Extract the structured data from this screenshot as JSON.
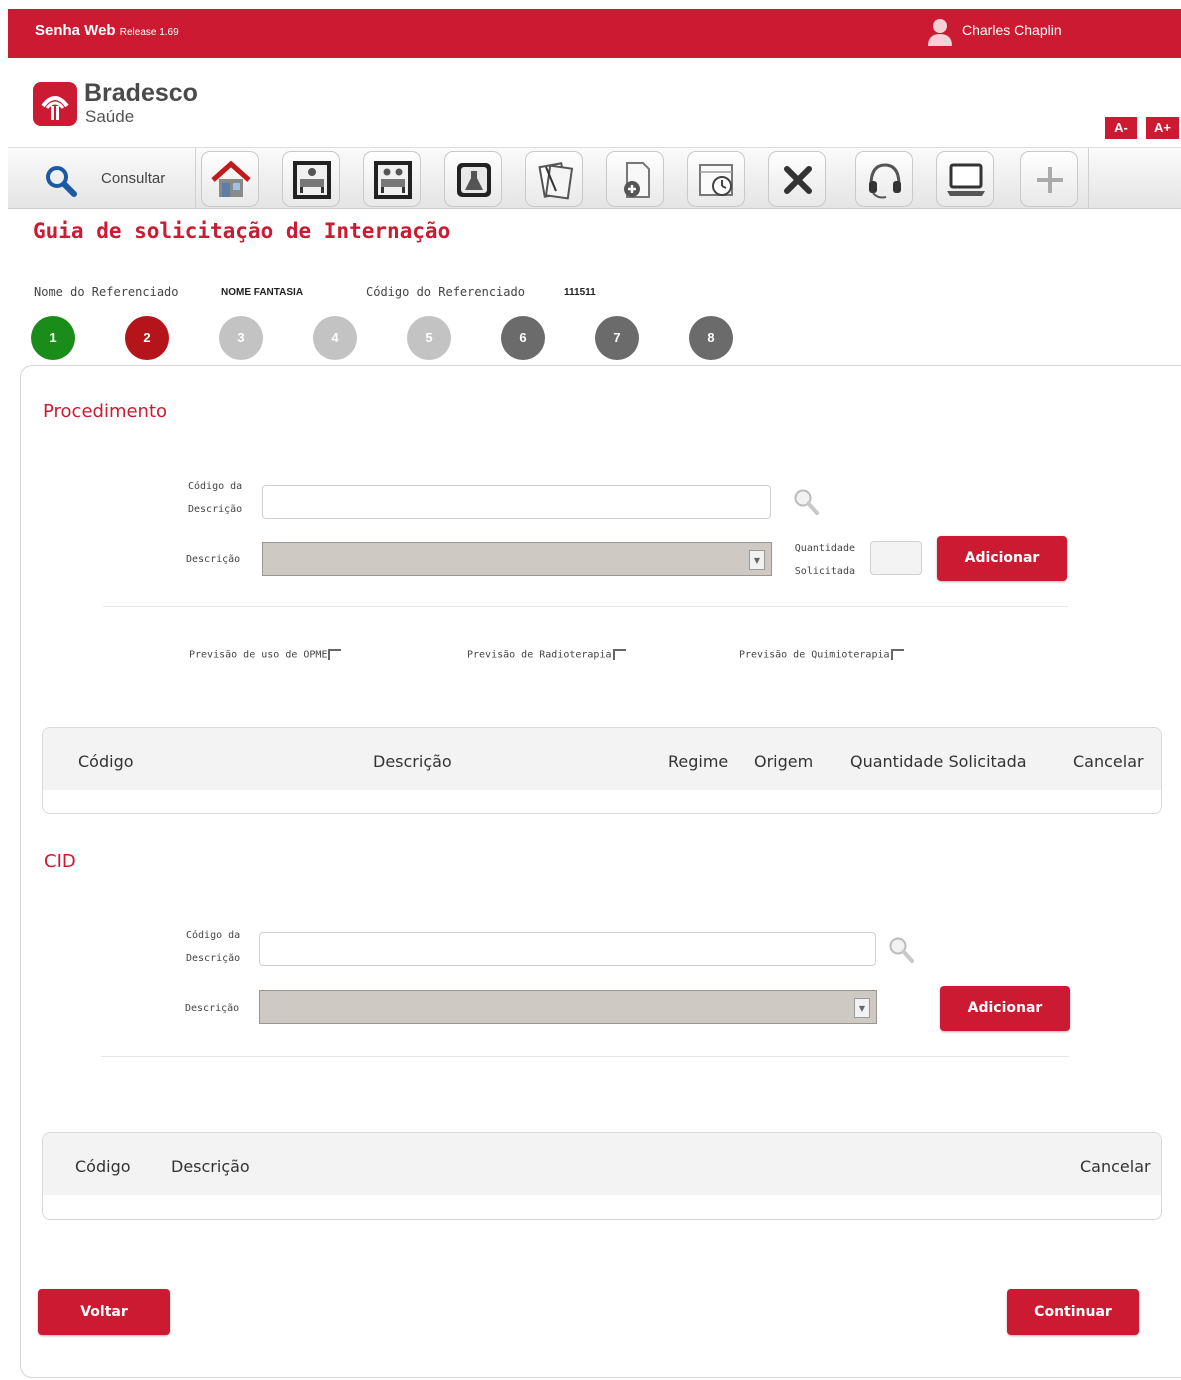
{
  "topbar": {
    "app_name": "Senha Web",
    "release": "Release 1.69",
    "user_name": "Charles Chaplin"
  },
  "logo": {
    "name": "Bradesco",
    "sub": "Saúde"
  },
  "font_size": {
    "decrease": "A-",
    "increase": "A+"
  },
  "toolbar": {
    "consultar_label": "Consultar",
    "icons": [
      "home-icon",
      "patient-bed-icon",
      "patients-bed-icon",
      "lab-flask-icon",
      "documents-icon",
      "add-document-icon",
      "calendar-clock-icon",
      "close-icon",
      "headset-icon",
      "laptop-icon",
      "plus-icon"
    ]
  },
  "page": {
    "title": "Guia de solicitação de Internação",
    "ref_name_label": "Nome do Referenciado",
    "ref_name_value": "NOME FANTASIA",
    "ref_code_label": "Código do Referenciado",
    "ref_code_value": "111511"
  },
  "steps": [
    {
      "n": "1",
      "state": "done",
      "color": "#1a8c1a"
    },
    {
      "n": "2",
      "state": "current",
      "color": "#b5141b"
    },
    {
      "n": "3",
      "state": "pending",
      "color": "#c3c3c3"
    },
    {
      "n": "4",
      "state": "pending",
      "color": "#c3c3c3"
    },
    {
      "n": "5",
      "state": "pending",
      "color": "#c3c3c3"
    },
    {
      "n": "6",
      "state": "locked",
      "color": "#6b6b6b"
    },
    {
      "n": "7",
      "state": "locked",
      "color": "#6b6b6b"
    },
    {
      "n": "8",
      "state": "locked",
      "color": "#6b6b6b"
    }
  ],
  "procedimento": {
    "title": "Procedimento",
    "codigo_label_1": "Código da",
    "codigo_label_2": "Descrição",
    "codigo_value": "",
    "descricao_label": "Descrição",
    "descricao_value": "",
    "quantidade_label_1": "Quantidade",
    "quantidade_label_2": "Solicitada",
    "quantidade_value": "",
    "add_label": "Adicionar",
    "opme_label": "Previsão de uso de OPME",
    "radio_label": "Previsão de Radioterapia",
    "quimio_label": "Previsão de Quimioterapia",
    "table_headers": {
      "codigo": "Código",
      "descricao": "Descrição",
      "regime": "Regime",
      "origem": "Origem",
      "quantidade": "Quantidade Solicitada",
      "cancelar": "Cancelar"
    }
  },
  "cid": {
    "title": "CID",
    "codigo_label_1": "Código da",
    "codigo_label_2": "Descrição",
    "codigo_value": "",
    "descricao_label": "Descrição",
    "descricao_value": "",
    "add_label": "Adicionar",
    "table_headers": {
      "codigo": "Código",
      "descricao": "Descrição",
      "cancelar": "Cancelar"
    }
  },
  "footer": {
    "back_label": "Voltar",
    "continue_label": "Continuar"
  },
  "colors": {
    "brand_red": "#cc1a32",
    "step_done": "#1a8c1a",
    "step_current": "#b5141b",
    "step_pending": "#c3c3c3",
    "step_locked": "#6b6b6b"
  }
}
